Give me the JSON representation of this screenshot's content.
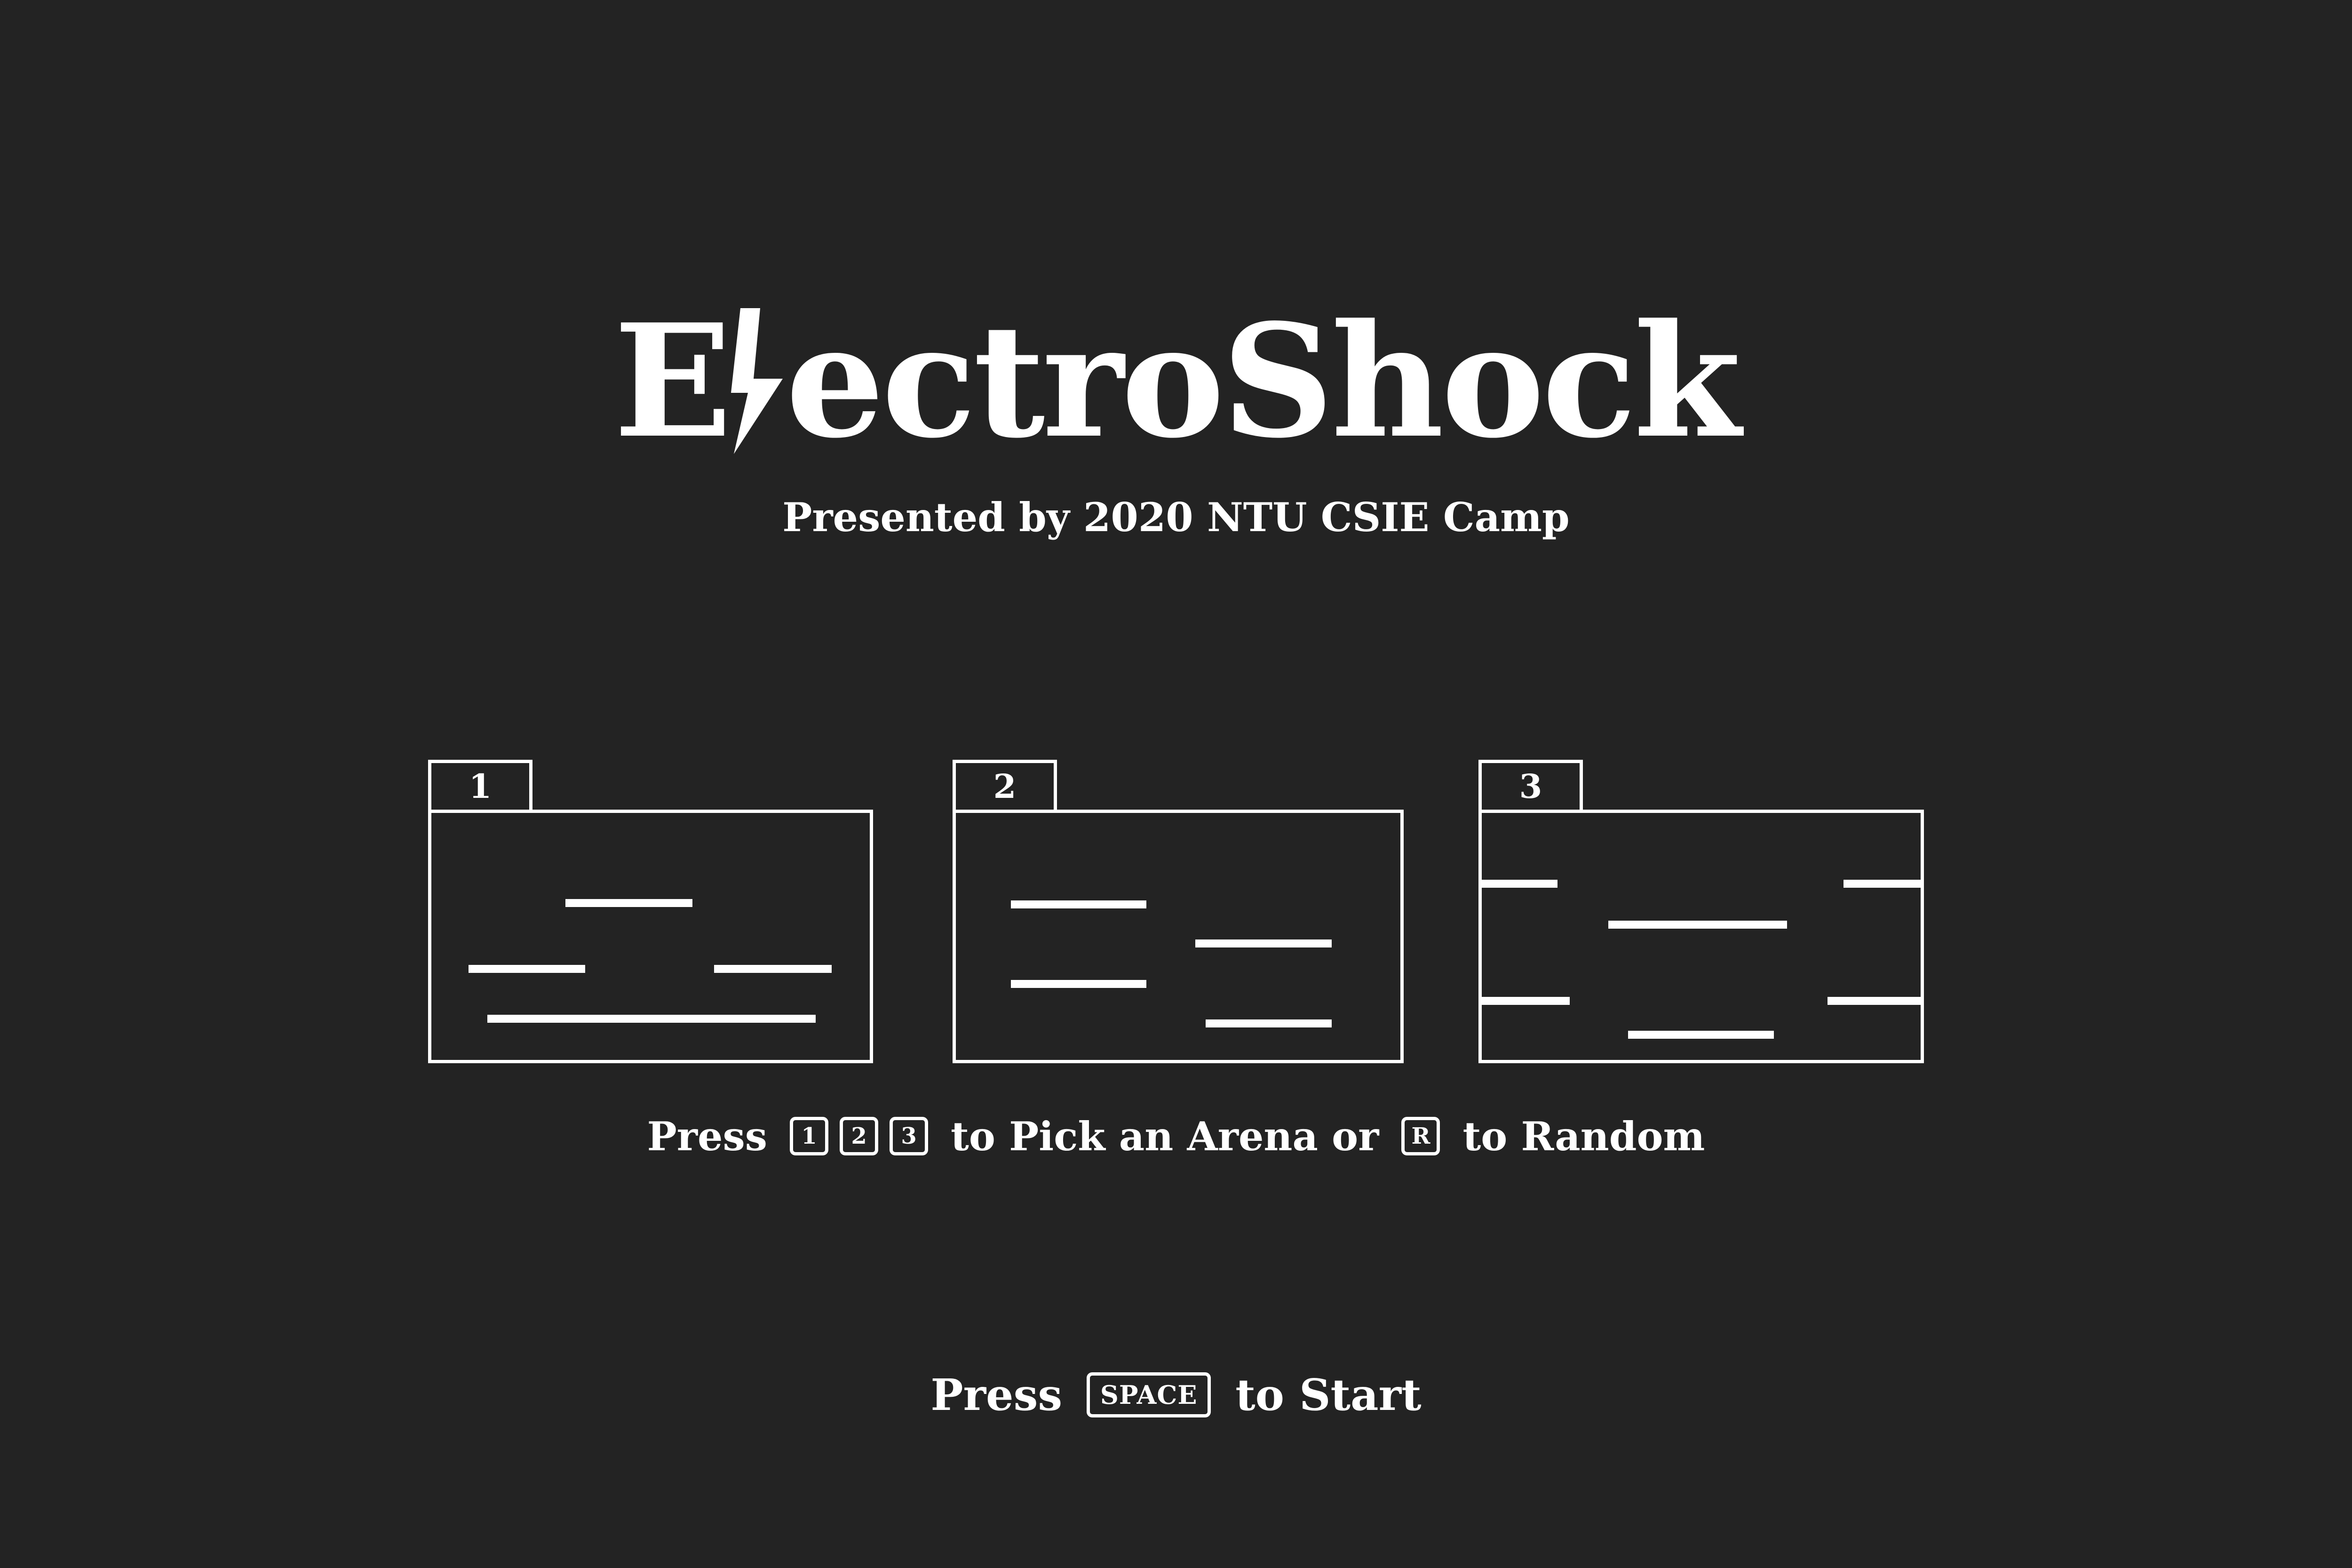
{
  "title": {
    "first_letter": "E",
    "rest": "ectroShock"
  },
  "subtitle": "Presented by 2020 NTU CSIE Camp",
  "arenas": [
    {
      "number": "1"
    },
    {
      "number": "2"
    },
    {
      "number": "3"
    }
  ],
  "arena_hint": {
    "press": "Press",
    "keys": [
      "1",
      "2",
      "3"
    ],
    "middle": "to Pick an Arena or",
    "random_key": "R",
    "end": "to Random"
  },
  "start_hint": {
    "press": "Press",
    "key": "SPACE",
    "end": "to Start"
  },
  "colors": {
    "background": "#232323",
    "foreground": "#ffffff"
  }
}
